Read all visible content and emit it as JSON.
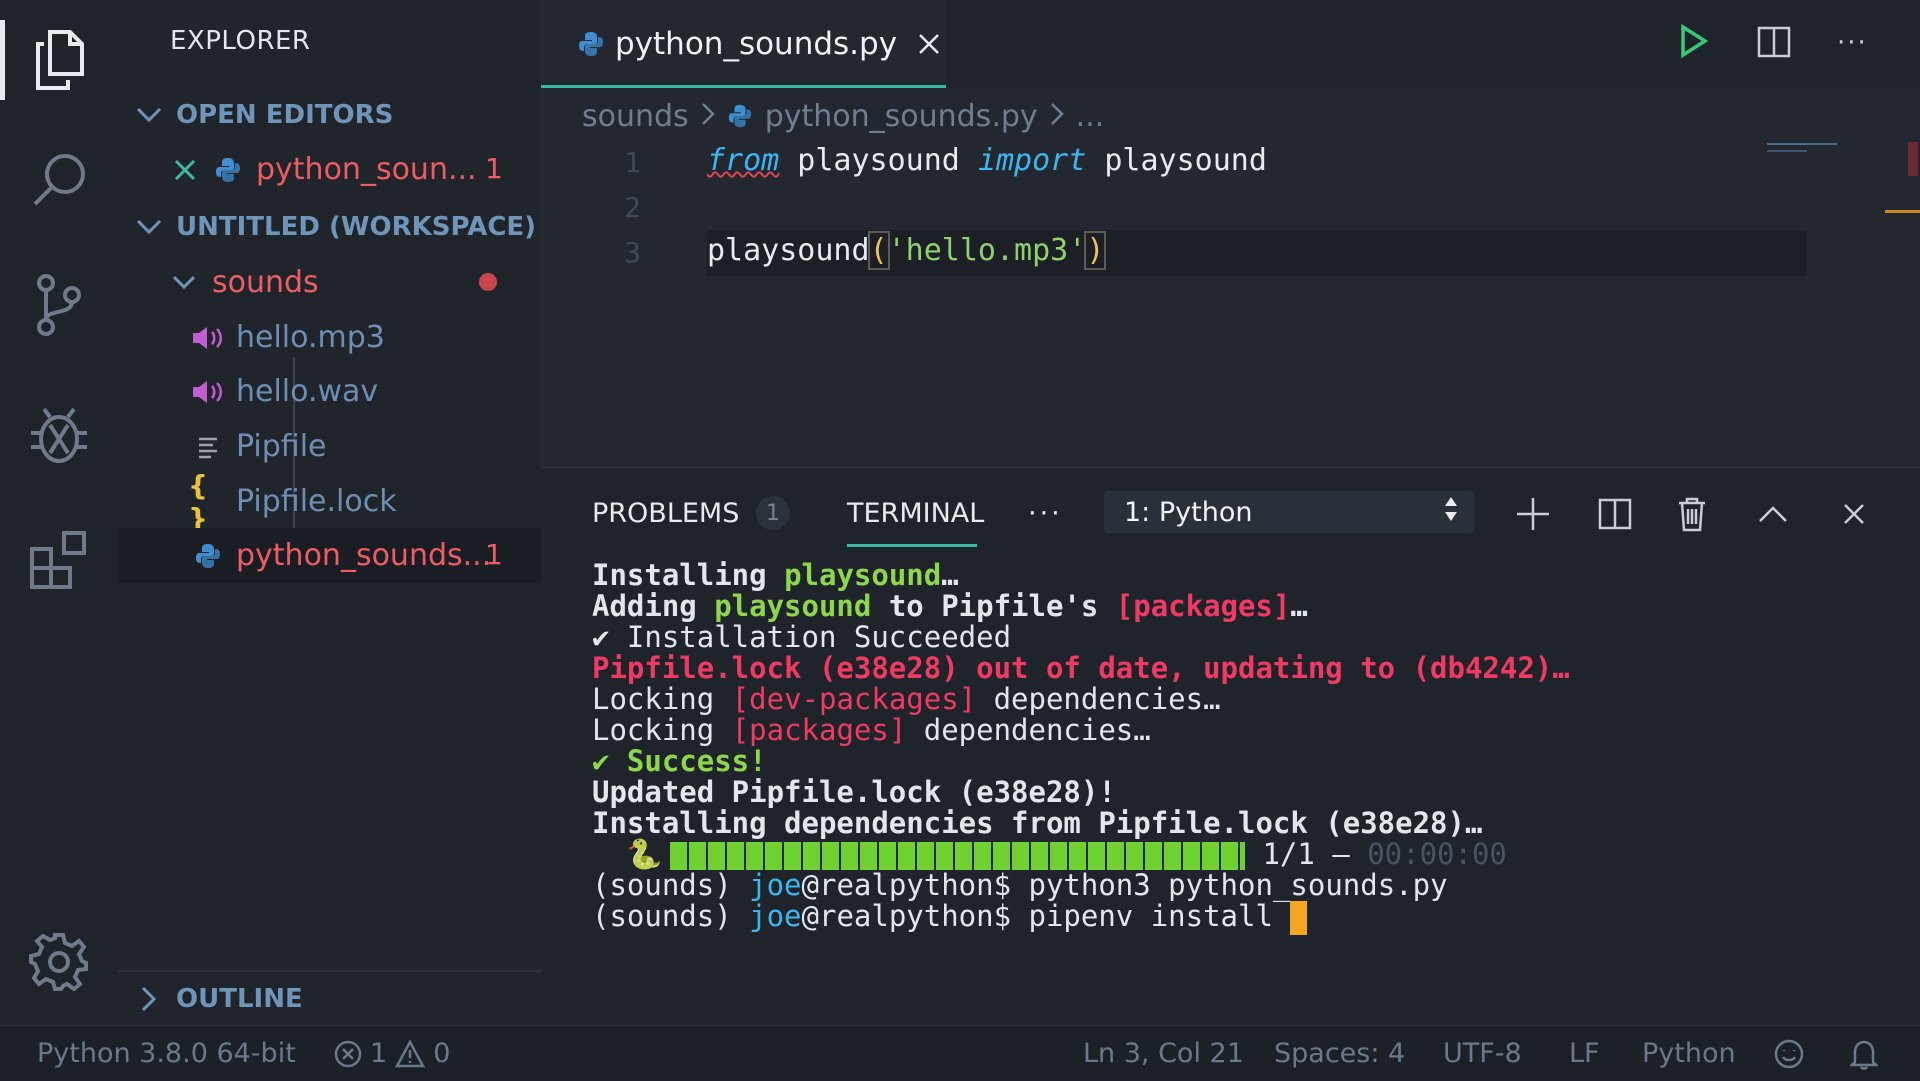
{
  "sidebar": {
    "title": "EXPLORER",
    "open_editors": {
      "label": "OPEN EDITORS",
      "items": [
        {
          "label": "python_soun...",
          "badge": "1"
        }
      ]
    },
    "workspace": {
      "label": "UNTITLED (WORKSPACE)",
      "folder": "sounds",
      "files": [
        {
          "label": "hello.mp3",
          "icon": "audio-icon"
        },
        {
          "label": "hello.wav",
          "icon": "audio-icon"
        },
        {
          "label": "Pipfile",
          "icon": "lines-file-icon"
        },
        {
          "label": "Pipfile.lock",
          "icon": "json-braces-icon"
        },
        {
          "label": "python_sounds...",
          "icon": "python-icon",
          "badge": "1"
        }
      ]
    },
    "outline_label": "OUTLINE"
  },
  "editor": {
    "tab_label": "python_sounds.py",
    "breadcrumbs": {
      "folder": "sounds",
      "file": "python_sounds.py",
      "more": "..."
    },
    "line_numbers": [
      "1",
      "2",
      "3"
    ],
    "line1": {
      "kw_from": "from",
      "mod": " playsound ",
      "kw_import": "import",
      "name": " playsound"
    },
    "line3": {
      "func": "playsound",
      "open": "(",
      "arg": "'hello.mp3'",
      "close": ")"
    }
  },
  "panel": {
    "problems_label": "PROBLEMS",
    "problems_count": "1",
    "terminal_label": "TERMINAL",
    "more": "···",
    "terminal_select": "1: Python",
    "terminal_lines": {
      "l1a": "Installing ",
      "l1b": "playsound",
      "l1c": "…",
      "l2a": "Adding ",
      "l2b": "playsound",
      "l2c": " to Pipfile's ",
      "l2d": "[packages]",
      "l2e": "…",
      "l3": "✔ Installation Succeeded",
      "l4": "Pipfile.lock (e38e28) out of date, updating to (db4242)…",
      "l5a": "Locking ",
      "l5b": "[dev-packages]",
      "l5c": " dependencies…",
      "l6a": "Locking ",
      "l6b": "[packages]",
      "l6c": " dependencies…",
      "l7": "✔ Success!",
      "l8": "Updated Pipfile.lock (e38e28)!",
      "l9": "Installing dependencies from Pipfile.lock (e38e28)…",
      "l10_emoji": "🐍",
      "l10_count": " 1/1 — ",
      "l10_time": "00:00:00",
      "progress": 1.0,
      "l11a": "(sounds) ",
      "l11b": "joe",
      "l11c": "@realpython$ python3 python_sounds.py",
      "l12a": "(sounds) ",
      "l12b": "joe",
      "l12c": "@realpython$ pipenv install "
    }
  },
  "status": {
    "interpreter": "Python 3.8.0 64-bit",
    "errors": "1",
    "warnings": "0",
    "position": "Ln 3, Col 21",
    "spaces": "Spaces: 4",
    "encoding": "UTF-8",
    "eol": "LF",
    "language": "Python"
  },
  "colors": {
    "accent": "#38b7a5",
    "error": "#ef5c63",
    "terminal_green": "#8ed64a",
    "terminal_red": "#f03a63",
    "keyword": "#3db5f0"
  }
}
